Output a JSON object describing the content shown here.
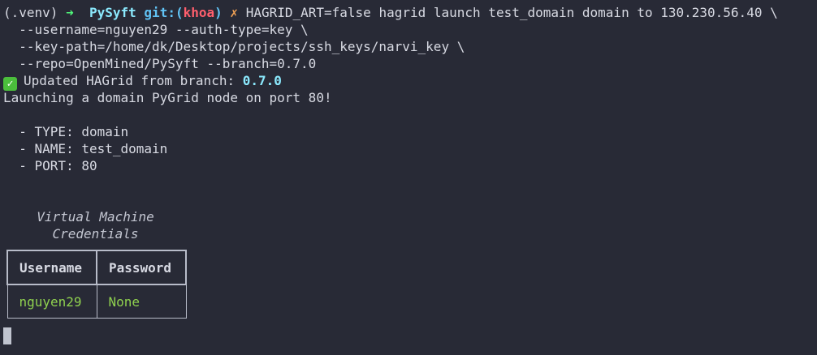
{
  "prompt": {
    "venv": "(.venv)",
    "arrow": "➜",
    "dir": "PySyft",
    "git_prefix": "git:(",
    "branch": "khoa",
    "git_suffix": ")",
    "dirty_mark": "✗",
    "command": "HAGRID_ART=false hagrid launch test_domain domain to 130.230.56.40 \\"
  },
  "continuation_lines": [
    "  --username=nguyen29 --auth-type=key \\",
    "  --key-path=/home/dk/Desktop/projects/ssh_keys/narvi_key \\",
    "  --repo=OpenMined/PySyft --branch=0.7.0"
  ],
  "output": {
    "check_icon": "✓",
    "updated_text": "Updated HAGrid from branch: ",
    "updated_branch": "0.7.0",
    "launching": "Launching a domain PyGrid node on port 80!",
    "details": [
      "  - TYPE: domain",
      "  - NAME: test_domain",
      "  - PORT: 80"
    ]
  },
  "credentials": {
    "title_line1": "Virtual Machine",
    "title_line2": "Credentials",
    "headers": [
      "Username",
      "Password"
    ],
    "row": [
      "nguyen29",
      "None"
    ]
  }
}
